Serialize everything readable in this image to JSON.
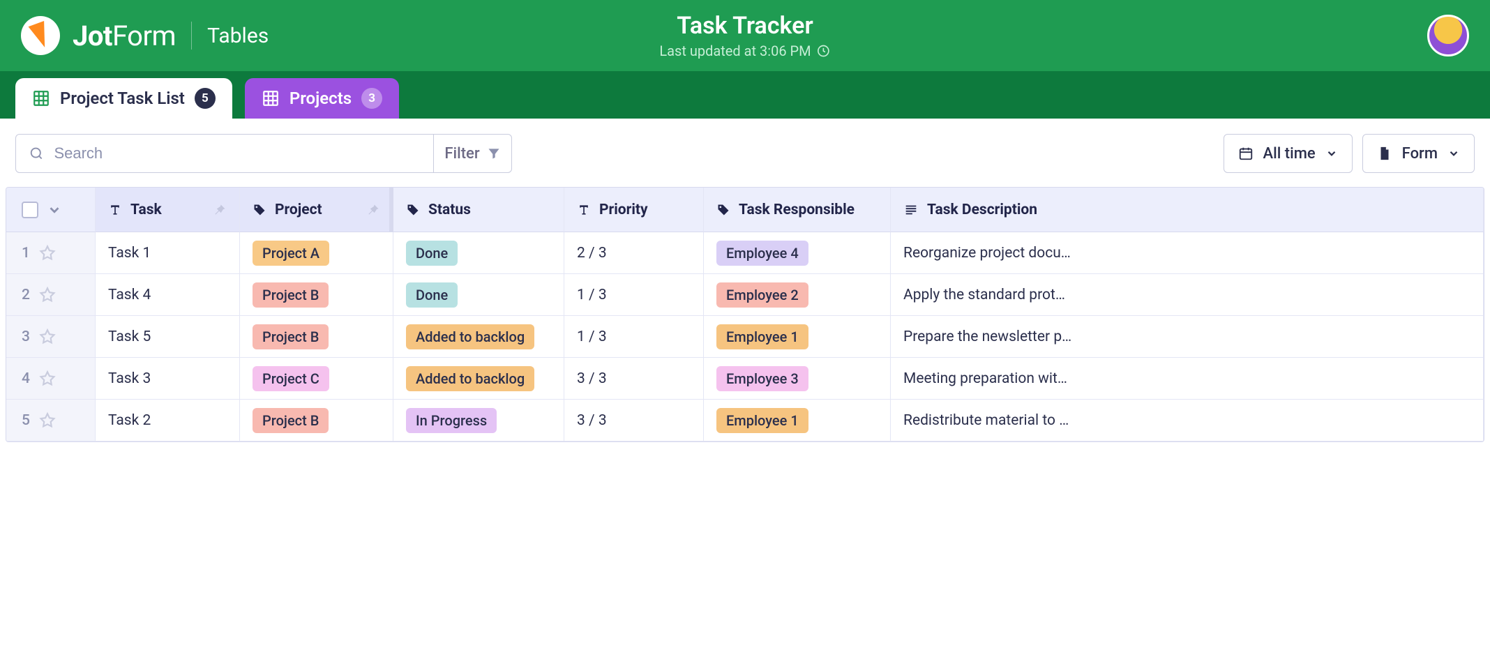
{
  "header": {
    "logo_text_bold": "Jot",
    "logo_text_light": "Form",
    "product_label": "Tables",
    "title": "Task Tracker",
    "last_updated": "Last updated at 3:06 PM"
  },
  "tabs": [
    {
      "label": "Project Task List",
      "count": "5",
      "active": true
    },
    {
      "label": "Projects",
      "count": "3",
      "active": false
    }
  ],
  "toolbar": {
    "search_placeholder": "Search",
    "filter_label": "Filter",
    "time_label": "All time",
    "form_label": "Form"
  },
  "columns": {
    "task": "Task",
    "project": "Project",
    "status": "Status",
    "priority": "Priority",
    "responsible": "Task Responsible",
    "description": "Task Description"
  },
  "tag_colors": {
    "Project A": "#f8c986",
    "Project B": "#f8b9b0",
    "Project C": "#f5c2ee",
    "Done": "#b7e1e2",
    "Added to backlog": "#f6c480",
    "In Progress": "#e4c3f5",
    "Employee 1": "#f6c480",
    "Employee 2": "#f8b9b0",
    "Employee 3": "#f5c2ee",
    "Employee 4": "#d9cff6"
  },
  "rows": [
    {
      "n": "1",
      "task": "Task 1",
      "project": "Project A",
      "status": "Done",
      "priority": "2 / 3",
      "responsible": "Employee 4",
      "description": "Reorganize project docu…"
    },
    {
      "n": "2",
      "task": "Task 4",
      "project": "Project B",
      "status": "Done",
      "priority": "1 / 3",
      "responsible": "Employee 2",
      "description": "Apply the standard prot…"
    },
    {
      "n": "3",
      "task": "Task 5",
      "project": "Project B",
      "status": "Added to backlog",
      "priority": "1 / 3",
      "responsible": "Employee 1",
      "description": "Prepare the newsletter p…"
    },
    {
      "n": "4",
      "task": "Task 3",
      "project": "Project C",
      "status": "Added to backlog",
      "priority": "3 / 3",
      "responsible": "Employee 3",
      "description": "Meeting preparation wit…"
    },
    {
      "n": "5",
      "task": "Task 2",
      "project": "Project B",
      "status": "In Progress",
      "priority": "3 / 3",
      "responsible": "Employee 1",
      "description": "Redistribute material to …"
    }
  ]
}
